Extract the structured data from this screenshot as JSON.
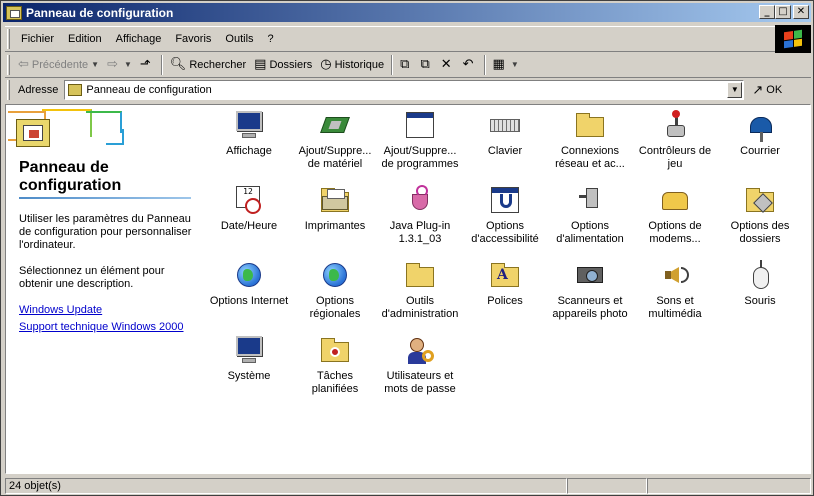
{
  "window": {
    "title": "Panneau de configuration"
  },
  "title_buttons": {
    "minimize": "_",
    "maximize": "□",
    "close": "✕"
  },
  "menu": [
    "Fichier",
    "Edition",
    "Affichage",
    "Favoris",
    "Outils",
    "?"
  ],
  "toolbar": {
    "back_label": "Précédente",
    "search_label": "Rechercher",
    "folders_label": "Dossiers",
    "history_label": "Historique"
  },
  "address": {
    "label": "Adresse",
    "value": "Panneau de configuration",
    "go_label": "OK"
  },
  "left_pane": {
    "title": "Panneau de configuration",
    "description": "Utiliser les paramètres du Panneau de configuration pour personnaliser l'ordinateur.",
    "hint": "Sélectionnez un élément pour obtenir une description.",
    "links": [
      "Windows Update",
      "Support technique Windows 2000"
    ]
  },
  "items": [
    {
      "label": "Affichage",
      "icon": "display-icon"
    },
    {
      "label": "Ajout/Suppre...\nde matériel",
      "icon": "add-hardware-icon"
    },
    {
      "label": "Ajout/Suppre...\nde programmes",
      "icon": "add-programs-icon"
    },
    {
      "label": "Clavier",
      "icon": "keyboard-icon"
    },
    {
      "label": "Connexions\nréseau et ac...",
      "icon": "network-connections-icon"
    },
    {
      "label": "Contrôleurs de\njeu",
      "icon": "game-controllers-icon"
    },
    {
      "label": "Courrier",
      "icon": "mail-icon"
    },
    {
      "label": "Date/Heure",
      "icon": "date-time-icon"
    },
    {
      "label": "Imprimantes",
      "icon": "printers-icon"
    },
    {
      "label": "Java Plug-in\n1.3.1_03",
      "icon": "java-icon"
    },
    {
      "label": "Options\nd'accessibilité",
      "icon": "accessibility-icon"
    },
    {
      "label": "Options\nd'alimentation",
      "icon": "power-icon"
    },
    {
      "label": "Options de\nmodems...",
      "icon": "modem-icon"
    },
    {
      "label": "Options des\ndossiers",
      "icon": "folder-options-icon"
    },
    {
      "label": "Options Internet",
      "icon": "internet-options-icon"
    },
    {
      "label": "Options\nrégionales",
      "icon": "regional-options-icon"
    },
    {
      "label": "Outils\nd'administration",
      "icon": "admin-tools-icon"
    },
    {
      "label": "Polices",
      "icon": "fonts-icon"
    },
    {
      "label": "Scanneurs et\nappareils photo",
      "icon": "scanner-icon"
    },
    {
      "label": "Sons et\nmultimédia",
      "icon": "sounds-icon"
    },
    {
      "label": "Souris",
      "icon": "mouse-icon"
    },
    {
      "label": "Système",
      "icon": "system-icon"
    },
    {
      "label": "Tâches\nplanifiées",
      "icon": "scheduled-tasks-icon"
    },
    {
      "label": "Utilisateurs et\nmots de passe",
      "icon": "users-icon"
    }
  ],
  "status": {
    "count": "24 objet(s)"
  }
}
